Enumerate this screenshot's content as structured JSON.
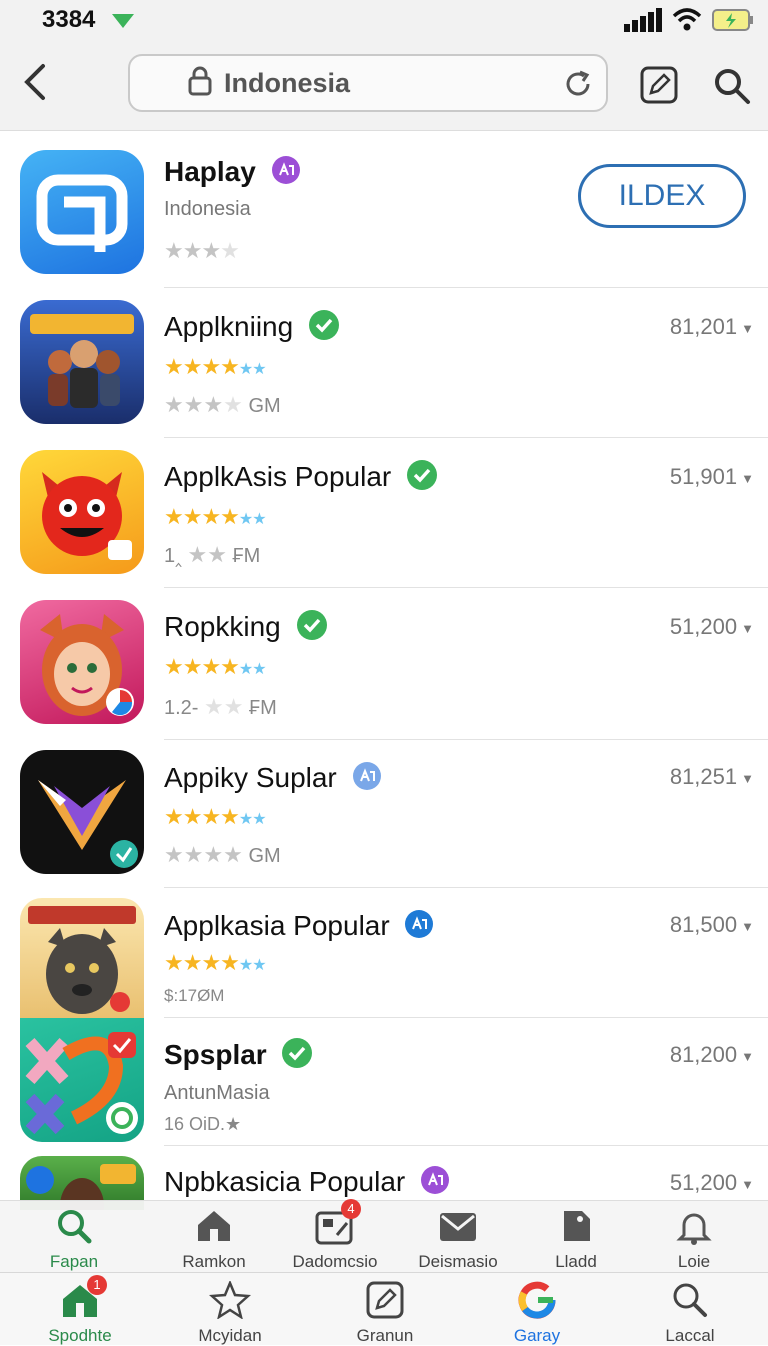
{
  "status_bar": {
    "time": "3384"
  },
  "top_bar": {
    "search_text": "Indonesia",
    "icons": [
      "back-icon",
      "lock-icon",
      "reload-icon",
      "edit-icon",
      "search-icon"
    ]
  },
  "featured": {
    "title": "Haplay",
    "subtitle": "Indonesia",
    "button_label": "ILDEX",
    "rating": 3
  },
  "apps": [
    {
      "title": "Applkniing",
      "count": "81,201",
      "meta": "GM",
      "badge": "verified"
    },
    {
      "title": "ApplkAsis Popular",
      "count": "51,901",
      "meta_prefix": "1‸",
      "meta": "₣M",
      "badge": "verified"
    },
    {
      "title": "Ropkking",
      "count": "51,200",
      "meta_prefix": "1.2-",
      "meta": "₣M",
      "badge": "verified"
    },
    {
      "title": "Appiky Suplar",
      "count": "81,251",
      "meta": "GM",
      "badge": "blue-tag"
    },
    {
      "title": "Applkasia Popular",
      "count": "81,500",
      "meta": "$:17ØM",
      "badge": "blue-tag"
    },
    {
      "title": "Spsplar",
      "subtitle": "AntunMasia",
      "count": "81,200",
      "meta": "16 OiD.★",
      "badge": "verified"
    },
    {
      "title": "Npbkasicia Popular",
      "count": "51,200",
      "badge": "purple-tag"
    }
  ],
  "category_bar": [
    {
      "label": "Fapan",
      "icon": "search-icon",
      "active": true
    },
    {
      "label": "Ramkon",
      "icon": "home-icon"
    },
    {
      "label": "Dadomcsio",
      "icon": "edit-icon",
      "badge": "4"
    },
    {
      "label": "Deismasio",
      "icon": "mail-icon"
    },
    {
      "label": "Lladd",
      "icon": "tag-icon"
    },
    {
      "label": "Loie",
      "icon": "bell-icon"
    }
  ],
  "tab_bar": [
    {
      "label": "Spodhte",
      "icon": "home-icon",
      "active": true,
      "badge": "1"
    },
    {
      "label": "Mcyidan",
      "icon": "star-icon"
    },
    {
      "label": "Granun",
      "icon": "edit-icon"
    },
    {
      "label": "Garay",
      "icon": "google-icon",
      "active": true
    },
    {
      "label": "Laccal",
      "icon": "search-icon"
    }
  ],
  "colors": {
    "accent": "#2d6fb3",
    "verified": "#3bb35a",
    "active_tab": "#2a8a4a",
    "notification": "#e53935"
  }
}
